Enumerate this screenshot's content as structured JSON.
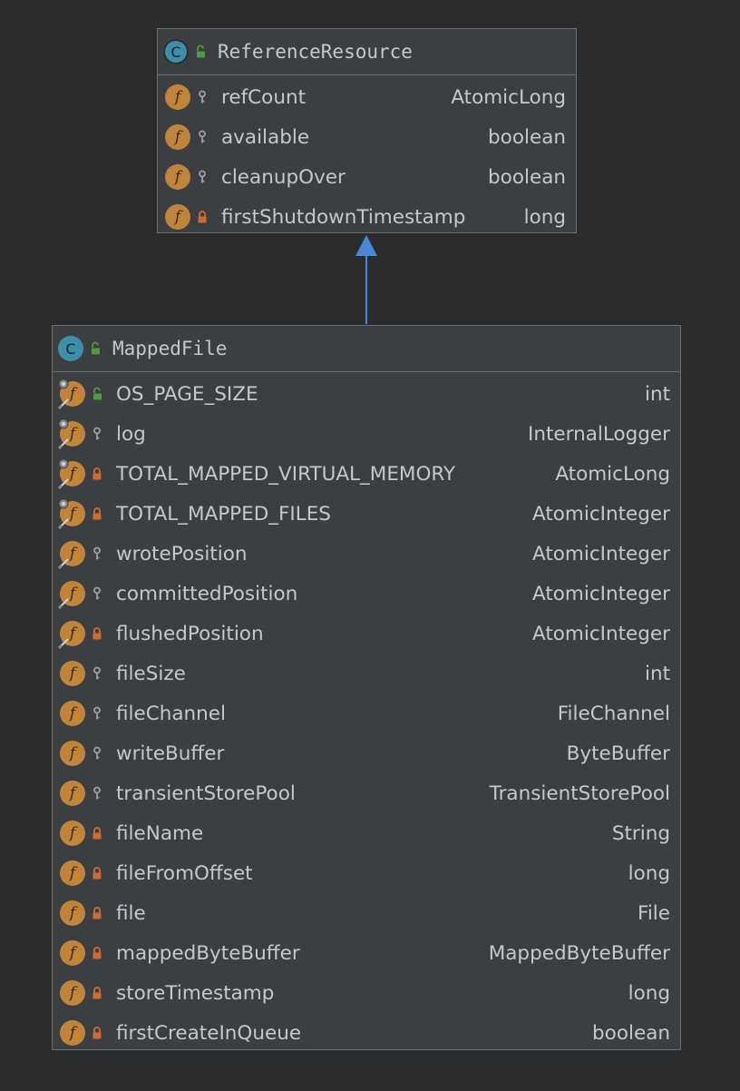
{
  "colors": {
    "background": "#2b2b2b",
    "class_fill": "#3c3f41",
    "border": "#6b6e70",
    "field_icon": "#c0853b",
    "class_icon": "#3e8ea8",
    "public_lock": "#4e9a3e",
    "private_lock": "#d06b32",
    "package_key": "#9da1a6",
    "inheritance_arrow": "#4a88d8"
  },
  "classes": [
    {
      "id": "cls-ref",
      "name": "ReferenceResource",
      "icon": "class-icon",
      "icon_letter": "C",
      "abstract": true,
      "visibility": "public",
      "fields": [
        {
          "name": "refCount",
          "type": "AtomicLong",
          "visibility": "package",
          "static": false,
          "final": false
        },
        {
          "name": "available",
          "type": "boolean",
          "visibility": "package",
          "static": false,
          "final": false
        },
        {
          "name": "cleanupOver",
          "type": "boolean",
          "visibility": "package",
          "static": false,
          "final": false
        },
        {
          "name": "firstShutdownTimestamp",
          "type": "long",
          "visibility": "private",
          "static": false,
          "final": false
        }
      ]
    },
    {
      "id": "cls-mapped",
      "name": "MappedFile",
      "icon": "class-icon",
      "icon_letter": "C",
      "abstract": false,
      "visibility": "public",
      "fields": [
        {
          "name": "OS_PAGE_SIZE",
          "type": "int",
          "visibility": "public",
          "static": true,
          "final": true
        },
        {
          "name": "log",
          "type": "InternalLogger",
          "visibility": "package",
          "static": true,
          "final": true
        },
        {
          "name": "TOTAL_MAPPED_VIRTUAL_MEMORY",
          "type": "AtomicLong",
          "visibility": "private",
          "static": true,
          "final": true
        },
        {
          "name": "TOTAL_MAPPED_FILES",
          "type": "AtomicInteger",
          "visibility": "private",
          "static": true,
          "final": true
        },
        {
          "name": "wrotePosition",
          "type": "AtomicInteger",
          "visibility": "package",
          "static": false,
          "final": true
        },
        {
          "name": "committedPosition",
          "type": "AtomicInteger",
          "visibility": "package",
          "static": false,
          "final": true
        },
        {
          "name": "flushedPosition",
          "type": "AtomicInteger",
          "visibility": "private",
          "static": false,
          "final": true
        },
        {
          "name": "fileSize",
          "type": "int",
          "visibility": "package",
          "static": false,
          "final": false
        },
        {
          "name": "fileChannel",
          "type": "FileChannel",
          "visibility": "package",
          "static": false,
          "final": false
        },
        {
          "name": "writeBuffer",
          "type": "ByteBuffer",
          "visibility": "package",
          "static": false,
          "final": false
        },
        {
          "name": "transientStorePool",
          "type": "TransientStorePool",
          "visibility": "package",
          "static": false,
          "final": false
        },
        {
          "name": "fileName",
          "type": "String",
          "visibility": "private",
          "static": false,
          "final": false
        },
        {
          "name": "fileFromOffset",
          "type": "long",
          "visibility": "private",
          "static": false,
          "final": false
        },
        {
          "name": "file",
          "type": "File",
          "visibility": "private",
          "static": false,
          "final": false
        },
        {
          "name": "mappedByteBuffer",
          "type": "MappedByteBuffer",
          "visibility": "private",
          "static": false,
          "final": false
        },
        {
          "name": "storeTimestamp",
          "type": "long",
          "visibility": "private",
          "static": false,
          "final": false
        },
        {
          "name": "firstCreateInQueue",
          "type": "boolean",
          "visibility": "private",
          "static": false,
          "final": false
        }
      ]
    }
  ],
  "relations": [
    {
      "type": "inheritance",
      "from": "MappedFile",
      "to": "ReferenceResource",
      "icon": "arrowhead-icon"
    }
  ]
}
